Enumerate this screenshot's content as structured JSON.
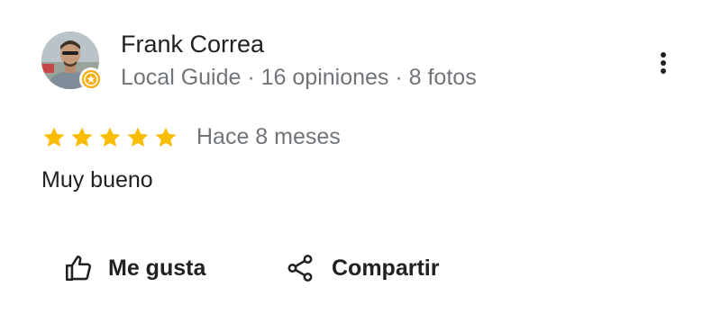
{
  "reviewer": {
    "name": "Frank Correa",
    "meta": "Local Guide · 16 opiniones · 8 fotos",
    "badge_icon": "local-guide-badge-icon",
    "badge_color": "#f9ab00"
  },
  "menu": {
    "icon": "more-vert-icon"
  },
  "review": {
    "rating": 5,
    "max_rating": 5,
    "star_color": "#fbbc04",
    "date": "Hace 8 meses",
    "text": "Muy bueno"
  },
  "actions": {
    "like_label": "Me gusta",
    "like_icon": "thumb-up-icon",
    "share_label": "Compartir",
    "share_icon": "share-icon"
  },
  "colors": {
    "primary_text": "#202124",
    "secondary_text": "#70757a"
  }
}
